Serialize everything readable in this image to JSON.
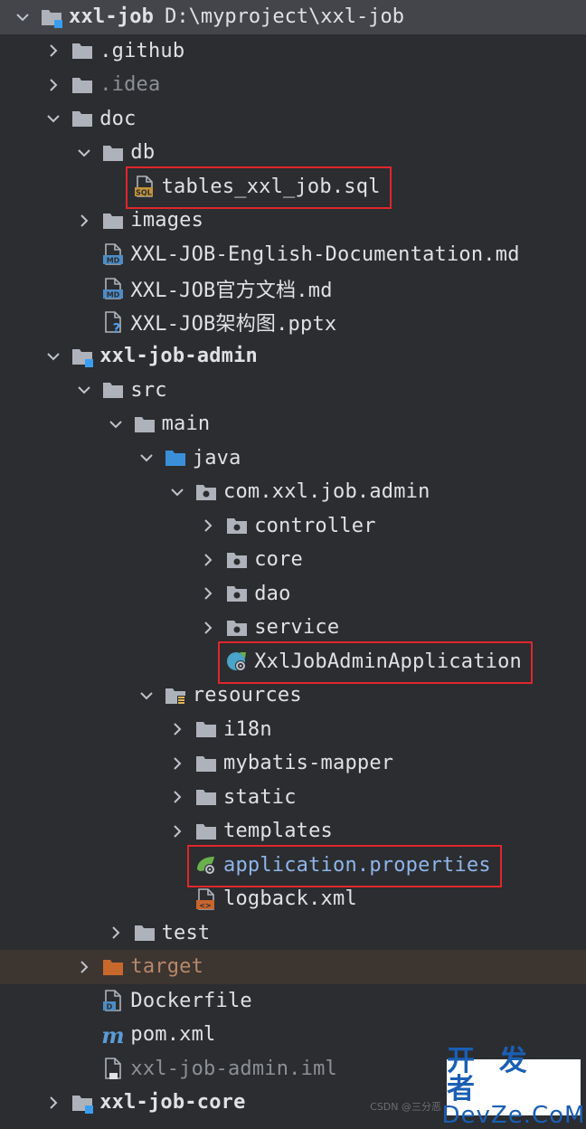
{
  "colors": {
    "background": "#2b2d30",
    "text": "#dfe1e5",
    "highlight_box": "#e0262b",
    "excluded_row": "#3d3530",
    "watermark_blue": "#1a5fb4"
  },
  "tree": [
    {
      "label": "xxl-job",
      "extra": "D:\\myproject\\xxl-job",
      "depth": 0,
      "state": "expanded",
      "icon": "module-folder-icon",
      "bold": true,
      "selected": true
    },
    {
      "label": ".github",
      "depth": 1,
      "state": "collapsed",
      "icon": "folder-icon"
    },
    {
      "label": ".idea",
      "depth": 1,
      "state": "collapsed",
      "icon": "folder-icon",
      "dim": true
    },
    {
      "label": "doc",
      "depth": 1,
      "state": "expanded",
      "icon": "folder-icon"
    },
    {
      "label": "db",
      "depth": 2,
      "state": "expanded",
      "icon": "folder-icon"
    },
    {
      "label": "tables_xxl_job.sql",
      "depth": 3,
      "state": "leaf",
      "icon": "sql-file-icon",
      "highlighted": true
    },
    {
      "label": "images",
      "depth": 2,
      "state": "collapsed",
      "icon": "folder-icon"
    },
    {
      "label": "XXL-JOB-English-Documentation.md",
      "depth": 2,
      "state": "leaf",
      "icon": "markdown-file-icon"
    },
    {
      "label": "XXL-JOB官方文档.md",
      "depth": 2,
      "state": "leaf",
      "icon": "markdown-file-icon"
    },
    {
      "label": "XXL-JOB架构图.pptx",
      "depth": 2,
      "state": "leaf",
      "icon": "unknown-file-icon"
    },
    {
      "label": "xxl-job-admin",
      "depth": 1,
      "state": "expanded",
      "icon": "module-folder-icon",
      "bold": true
    },
    {
      "label": "src",
      "depth": 2,
      "state": "expanded",
      "icon": "folder-icon"
    },
    {
      "label": "main",
      "depth": 3,
      "state": "expanded",
      "icon": "folder-icon"
    },
    {
      "label": "java",
      "depth": 4,
      "state": "expanded",
      "icon": "source-folder-icon"
    },
    {
      "label": "com.xxl.job.admin",
      "depth": 5,
      "state": "expanded",
      "icon": "package-icon"
    },
    {
      "label": "controller",
      "depth": 6,
      "state": "collapsed",
      "icon": "package-icon"
    },
    {
      "label": "core",
      "depth": 6,
      "state": "collapsed",
      "icon": "package-icon"
    },
    {
      "label": "dao",
      "depth": 6,
      "state": "collapsed",
      "icon": "package-icon"
    },
    {
      "label": "service",
      "depth": 6,
      "state": "collapsed",
      "icon": "package-icon"
    },
    {
      "label": "XxlJobAdminApplication",
      "depth": 6,
      "state": "leaf",
      "icon": "spring-boot-class-icon",
      "highlighted": true
    },
    {
      "label": "resources",
      "depth": 4,
      "state": "expanded",
      "icon": "resources-folder-icon"
    },
    {
      "label": "i18n",
      "depth": 5,
      "state": "collapsed",
      "icon": "folder-icon"
    },
    {
      "label": "mybatis-mapper",
      "depth": 5,
      "state": "collapsed",
      "icon": "folder-icon"
    },
    {
      "label": "static",
      "depth": 5,
      "state": "collapsed",
      "icon": "folder-icon"
    },
    {
      "label": "templates",
      "depth": 5,
      "state": "collapsed",
      "icon": "folder-icon"
    },
    {
      "label": "application.properties",
      "depth": 5,
      "state": "leaf",
      "icon": "spring-properties-icon",
      "blue": true,
      "highlighted": true
    },
    {
      "label": "logback.xml",
      "depth": 5,
      "state": "leaf",
      "icon": "xml-file-icon"
    },
    {
      "label": "test",
      "depth": 3,
      "state": "collapsed",
      "icon": "folder-icon"
    },
    {
      "label": "target",
      "depth": 2,
      "state": "collapsed",
      "icon": "excluded-folder-icon",
      "orange": true,
      "excluded": true
    },
    {
      "label": "Dockerfile",
      "depth": 2,
      "state": "leaf",
      "icon": "dockerfile-icon"
    },
    {
      "label": "pom.xml",
      "depth": 2,
      "state": "leaf",
      "icon": "maven-icon"
    },
    {
      "label": "xxl-job-admin.iml",
      "depth": 2,
      "state": "leaf",
      "icon": "iml-file-icon",
      "dim": true
    },
    {
      "label": "xxl-job-core",
      "depth": 1,
      "state": "collapsed",
      "icon": "module-folder-icon",
      "bold": true
    }
  ],
  "watermark": {
    "cn": "开 发 者",
    "en": "DevZe.CoM",
    "faint": "CSDN @三分恶"
  }
}
